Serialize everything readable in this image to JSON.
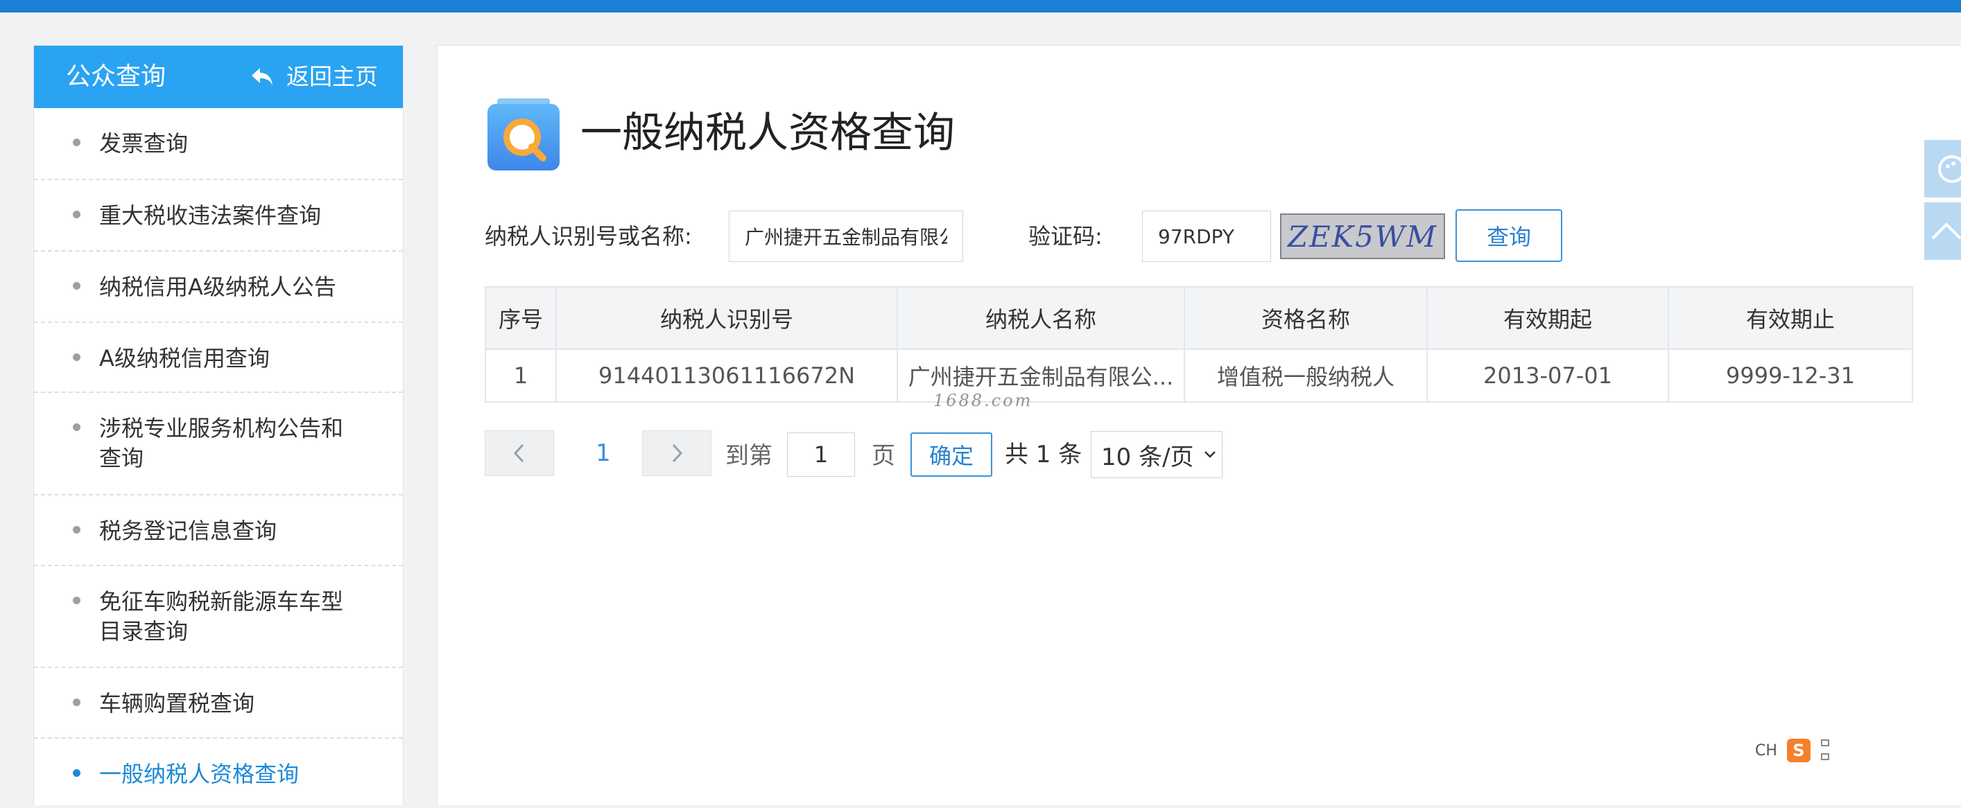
{
  "sidebar": {
    "title": "公众查询",
    "back_label": "返回主页",
    "items": [
      {
        "label": "发票查询"
      },
      {
        "label": "重大税收违法案件查询"
      },
      {
        "label": "纳税信用A级纳税人公告"
      },
      {
        "label": "A级纳税信用查询"
      },
      {
        "label": "涉税专业服务机构公告和查询"
      },
      {
        "label": "税务登记信息查询"
      },
      {
        "label": "免征车购税新能源车车型目录查询"
      },
      {
        "label": "车辆购置税查询"
      },
      {
        "label": "一般纳税人资格查询",
        "active": true
      }
    ]
  },
  "main": {
    "page_title": "一般纳税人资格查询",
    "form": {
      "taxpayer_label": "纳税人识别号或名称:",
      "taxpayer_value": "广州捷开五金制品有限公",
      "captcha_label": "验证码:",
      "captcha_value": "97RDPY",
      "captcha_image_text": "ZEK5WM",
      "query_button": "查询"
    },
    "table": {
      "headers": [
        "序号",
        "纳税人识别号",
        "纳税人名称",
        "资格名称",
        "有效期起",
        "有效期止"
      ],
      "rows": [
        [
          "1",
          "91440113061116672N",
          "广州捷开五金制品有限公...",
          "增值税一般纳税人",
          "2013-07-01",
          "9999-12-31"
        ]
      ]
    },
    "watermark": "1688.com",
    "pagination": {
      "current_page": "1",
      "goto_label": "到第",
      "goto_value": "1",
      "page_unit": "页",
      "confirm": "确定",
      "total": "共 1 条",
      "page_size": "10 条/页"
    }
  },
  "ime": {
    "lang": "CH",
    "logo": "S"
  },
  "colors": {
    "accent": "#2aa3f2",
    "topbar": "#1d7fd6",
    "link": "#1d8ad8"
  }
}
